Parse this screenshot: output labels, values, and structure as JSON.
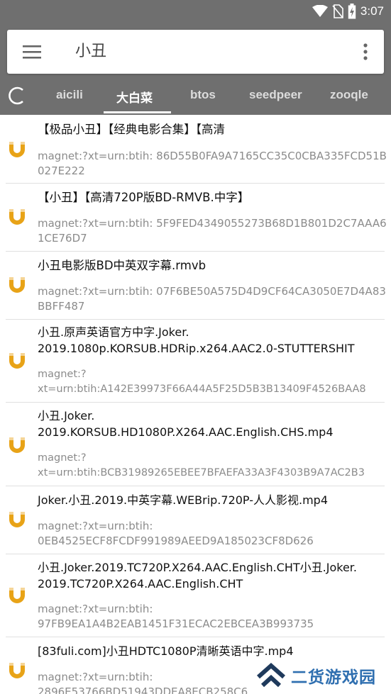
{
  "status_bar": {
    "time": "3:07"
  },
  "search": {
    "query": "小丑"
  },
  "tabs": [
    {
      "label": "aicili"
    },
    {
      "label": "大白菜"
    },
    {
      "label": "btos"
    },
    {
      "label": "seedpeer"
    },
    {
      "label": "zooqle"
    }
  ],
  "active_tab": "大白菜",
  "results": [
    {
      "title": "【极品小丑】【经典电影合集】【高清",
      "magnet": "magnet:?xt=urn:btih:\n86D55B0FA9A7165CC35C0CBA335FCD51B027E222"
    },
    {
      "title": "【小丑】【高清720P版BD-RMVB.中字】",
      "magnet": "magnet:?xt=urn:btih:\n5F9FED4349055273B68D1B801D2C7AAA61CE76D7"
    },
    {
      "title": "小丑电影版BD中英双字幕.rmvb",
      "magnet": "magnet:?xt=urn:btih:\n07F6BE50A575D4D9CF64CA3050E7D4A83BBFF487"
    },
    {
      "title": "小丑.原声英语官方中字.Joker.\n2019.1080p.KORSUB.HDRip.x264.AAC2.0-STUTTERSHIT",
      "magnet": "magnet:?\nxt=urn:btih:A142E39973F66A44A5F25D5B3B13409F4526BAA8"
    },
    {
      "title": "小丑.Joker.\n2019.KORSUB.HD1080P.X264.AAC.English.CHS.mp4",
      "magnet": "magnet:?\nxt=urn:btih:BCB31989265EBEE7BFAEFA33A3F4303B9A7AC2B3"
    },
    {
      "title": "Joker.小丑.2019.中英字幕.WEBrip.720P-人人影视.mp4",
      "magnet": "magnet:?xt=urn:btih:\n0EB4525ECF8FCDF991989AEED9A185023CF8D626"
    },
    {
      "title": "小丑.Joker.2019.TC720P.X264.AAC.English.CHT小丑.Joker.\n2019.TC720P.X264.AAC.English.CHT",
      "magnet": "magnet:?xt=urn:btih:\n97FB9EA1A4B2EAB1451F31ECAC2EBCEA3B993735"
    },
    {
      "title": "[83fuli.com]小丑HDTC1080P清晰英语中字.mp4",
      "magnet": "magnet:?xt=urn:btih:\n2896E53766BD51943DDEA8ECB258C6"
    }
  ],
  "watermark": {
    "text": "二货游戏园"
  },
  "colors": {
    "toolbar": "#6f6f6f",
    "magnet_icon": "#e8a317",
    "watermark": "#2f6fb0"
  },
  "icons": {
    "menu": "menu-icon",
    "more": "more-vert-icon",
    "refresh": "refresh-icon",
    "result": "magnet-icon"
  }
}
